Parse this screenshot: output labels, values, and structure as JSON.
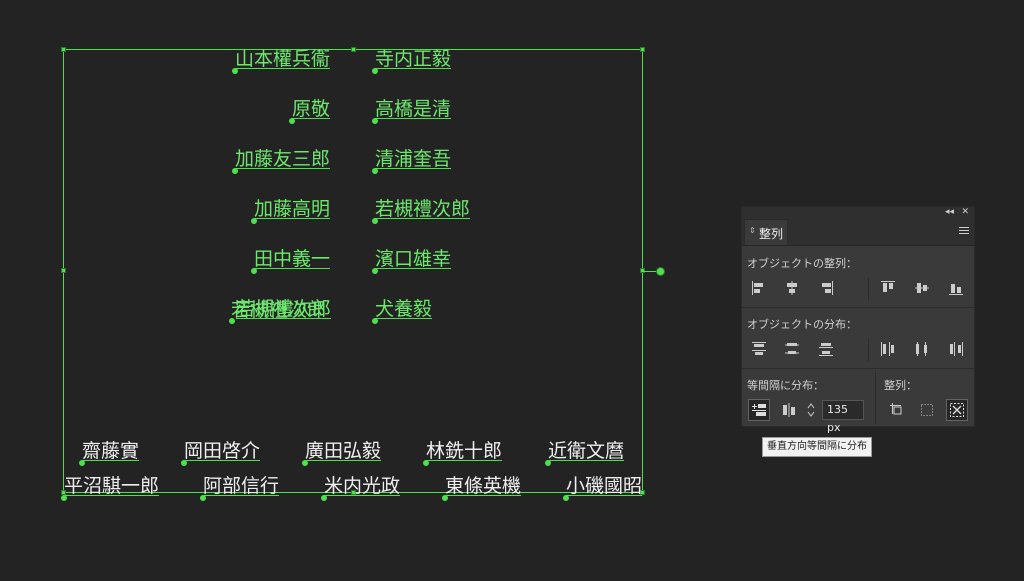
{
  "canvas": {
    "top_left_names": [
      "山本權兵衞",
      "原敬",
      "加藤友三郎",
      "加藤高明",
      "田中義一",
      "若槻禮次郎"
    ],
    "top_right_names": [
      "寺内正毅",
      "高橋是清",
      "清浦奎吾",
      "若槻禮次郎",
      "濱口雄幸",
      "犬養毅"
    ],
    "overlapped_name": "若槻禮次郎",
    "bottom_row1": [
      "齋藤實",
      "岡田啓介",
      "廣田弘毅",
      "林銑十郎",
      "近衛文麿"
    ],
    "bottom_row2": [
      "平沼騏一郎",
      "阿部信行",
      "米内光政",
      "東條英機",
      "小磯國昭"
    ]
  },
  "panel": {
    "tab_label": "整列",
    "collapse_icon": "double-chevron-left-icon",
    "close_icon": "close-icon",
    "section_align_title": "オブジェクトの整列：",
    "section_distribute_title": "オブジェクトの分布：",
    "section_spacing_title": "等間隔に分布：",
    "section_alignto_title": "整列：",
    "spacing_value": "135 px"
  },
  "tooltip": "垂直方向等間隔に分布",
  "colors": {
    "selection": "#4ee04e",
    "text_green": "#6ce86c",
    "background": "#232323"
  }
}
